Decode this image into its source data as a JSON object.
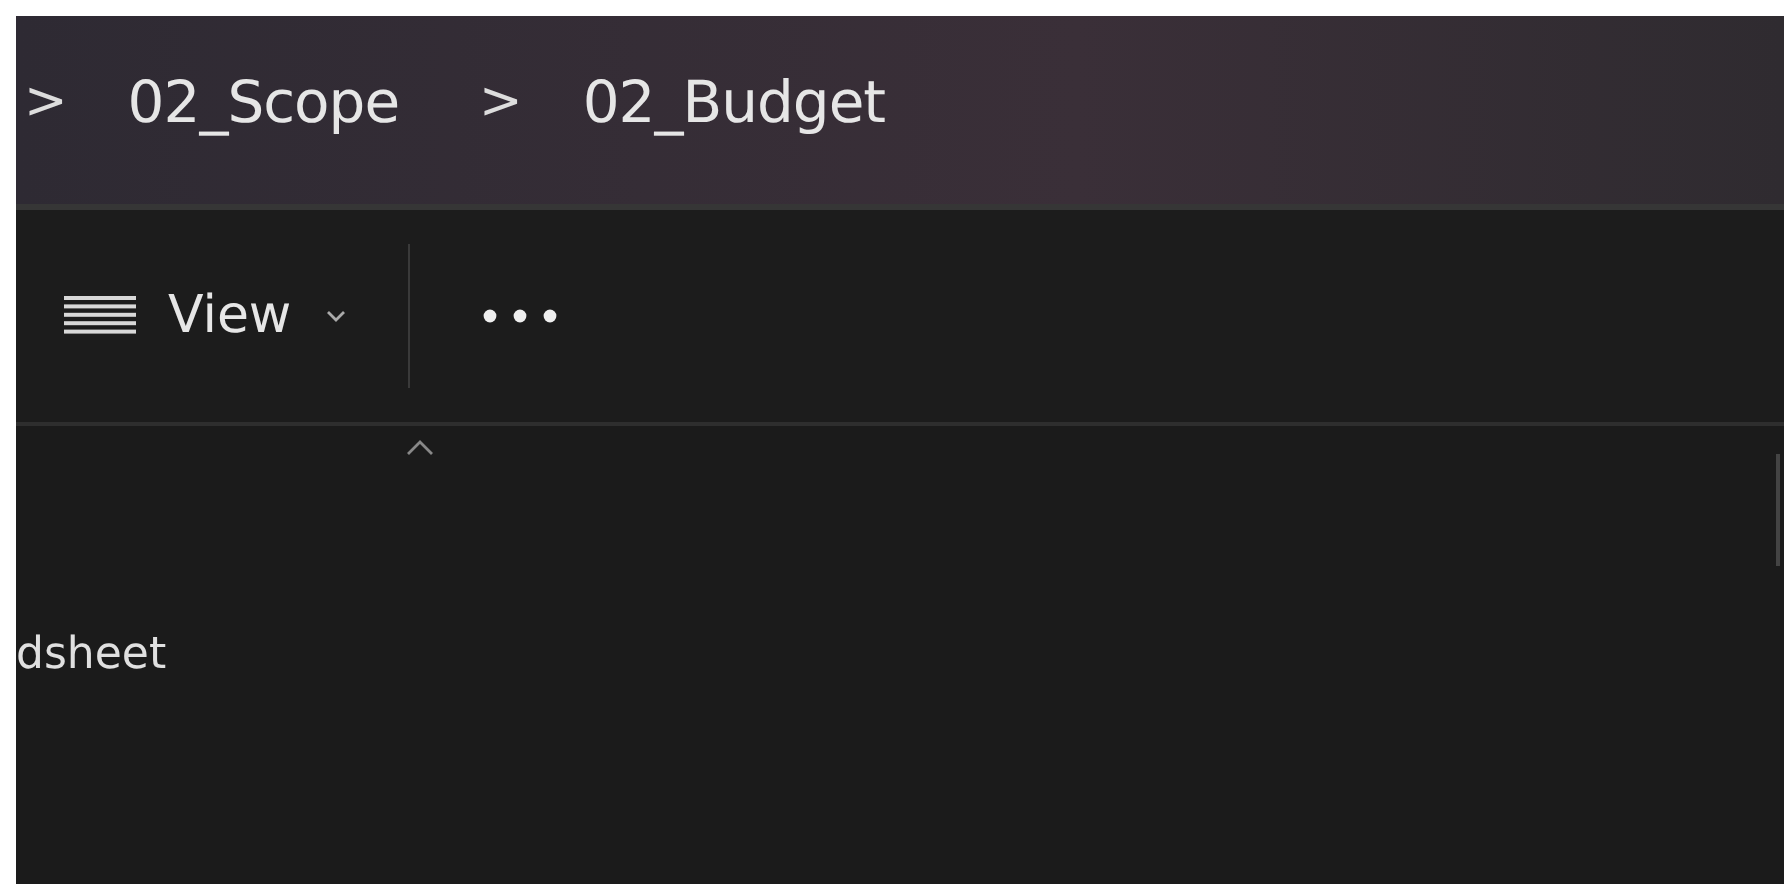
{
  "address_bar": {
    "breadcrumb": [
      {
        "separator": ">",
        "label": "02_Scope"
      },
      {
        "separator": ">",
        "label": "02_Budget"
      }
    ]
  },
  "toolbar": {
    "view_button": {
      "label": "View"
    }
  },
  "file_list": {
    "rows": [
      {
        "cells": [
          "dsheet"
        ]
      }
    ]
  }
}
